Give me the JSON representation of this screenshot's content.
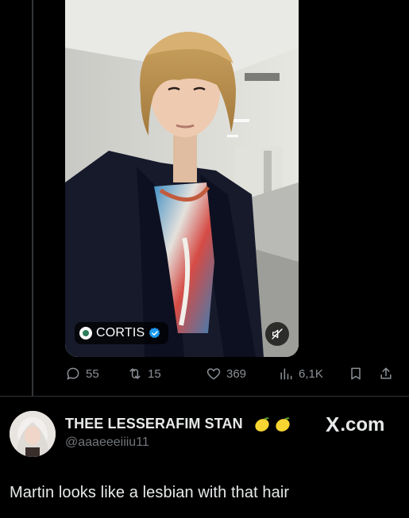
{
  "colors": {
    "background": "#000000",
    "text_primary": "#e7e9ea",
    "text_secondary": "#71767b",
    "verified_blue": "#1d9bf0",
    "lemon_yellow": "#f7d532"
  },
  "embedded_post": {
    "source_label": "CORTIS",
    "source_icon": "cortis-logo-icon",
    "verified": true,
    "video_muted": true
  },
  "actions": {
    "replies": "55",
    "reposts": "15",
    "likes": "369",
    "views": "6,1K"
  },
  "quote": {
    "author_name": "THEE LESSERAFIM STAN",
    "author_emoji": [
      "lemon",
      "lemon"
    ],
    "handle": "@aaaeeeiiiu11",
    "brand_x": "X",
    "brand_domain": ".com",
    "text": "Martin looks like a lesbian with that hair"
  }
}
